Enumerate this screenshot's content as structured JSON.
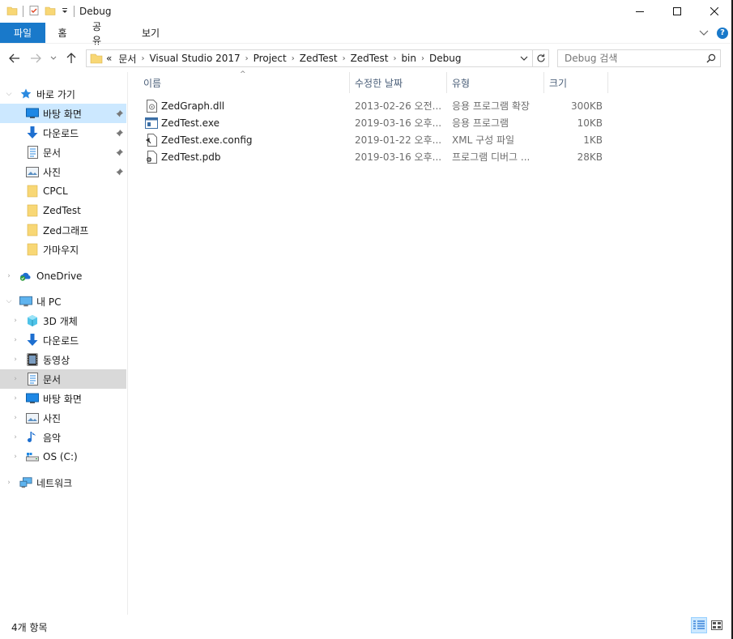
{
  "window": {
    "title": "Debug"
  },
  "ribbon": {
    "tabs": [
      "파일",
      "홈",
      "공유",
      "보기"
    ],
    "help_label": "?"
  },
  "address": {
    "overflow": "«",
    "crumbs": [
      "문서",
      "Visual Studio 2017",
      "Project",
      "ZedTest",
      "ZedTest",
      "bin",
      "Debug"
    ]
  },
  "search": {
    "placeholder": "Debug 검색"
  },
  "nav": {
    "quick_access": "바로 가기",
    "quick_items": [
      {
        "label": "바탕 화면",
        "icon": "desktop-icon",
        "pinned": true
      },
      {
        "label": "다운로드",
        "icon": "download-icon",
        "pinned": true
      },
      {
        "label": "문서",
        "icon": "documents-icon",
        "pinned": true
      },
      {
        "label": "사진",
        "icon": "pictures-icon",
        "pinned": true
      },
      {
        "label": "CPCL",
        "icon": "folder-icon",
        "pinned": false
      },
      {
        "label": "ZedTest",
        "icon": "folder-icon",
        "pinned": false
      },
      {
        "label": "Zed그래프",
        "icon": "folder-icon",
        "pinned": false
      },
      {
        "label": "가마우지",
        "icon": "folder-icon",
        "pinned": false
      }
    ],
    "onedrive": "OneDrive",
    "this_pc": "내 PC",
    "pc_items": [
      {
        "label": "3D 개체",
        "icon": "3d-objects-icon"
      },
      {
        "label": "다운로드",
        "icon": "download-icon"
      },
      {
        "label": "동영상",
        "icon": "videos-icon"
      },
      {
        "label": "문서",
        "icon": "documents-icon"
      },
      {
        "label": "바탕 화면",
        "icon": "desktop-icon"
      },
      {
        "label": "사진",
        "icon": "pictures-icon"
      },
      {
        "label": "음악",
        "icon": "music-icon"
      },
      {
        "label": "OS (C:)",
        "icon": "drive-icon"
      }
    ],
    "network": "네트워크"
  },
  "columns": {
    "name": "이름",
    "date": "수정한 날짜",
    "type": "유형",
    "size": "크기"
  },
  "files": [
    {
      "name": "ZedGraph.dll",
      "date": "2013-02-26 오전...",
      "type": "응용 프로그램 확장",
      "size": "300KB",
      "icon": "dll-file-icon"
    },
    {
      "name": "ZedTest.exe",
      "date": "2019-03-16 오후...",
      "type": "응용 프로그램",
      "size": "10KB",
      "icon": "exe-file-icon"
    },
    {
      "name": "ZedTest.exe.config",
      "date": "2019-01-22 오후...",
      "type": "XML 구성 파일",
      "size": "1KB",
      "icon": "config-file-icon"
    },
    {
      "name": "ZedTest.pdb",
      "date": "2019-03-16 오후...",
      "type": "프로그램 디버그 ...",
      "size": "28KB",
      "icon": "pdb-file-icon"
    }
  ],
  "status": {
    "item_count": "4개 항목"
  },
  "colors": {
    "accent": "#1979ca",
    "selected": "#cce8ff",
    "folder": "#f8d775"
  }
}
